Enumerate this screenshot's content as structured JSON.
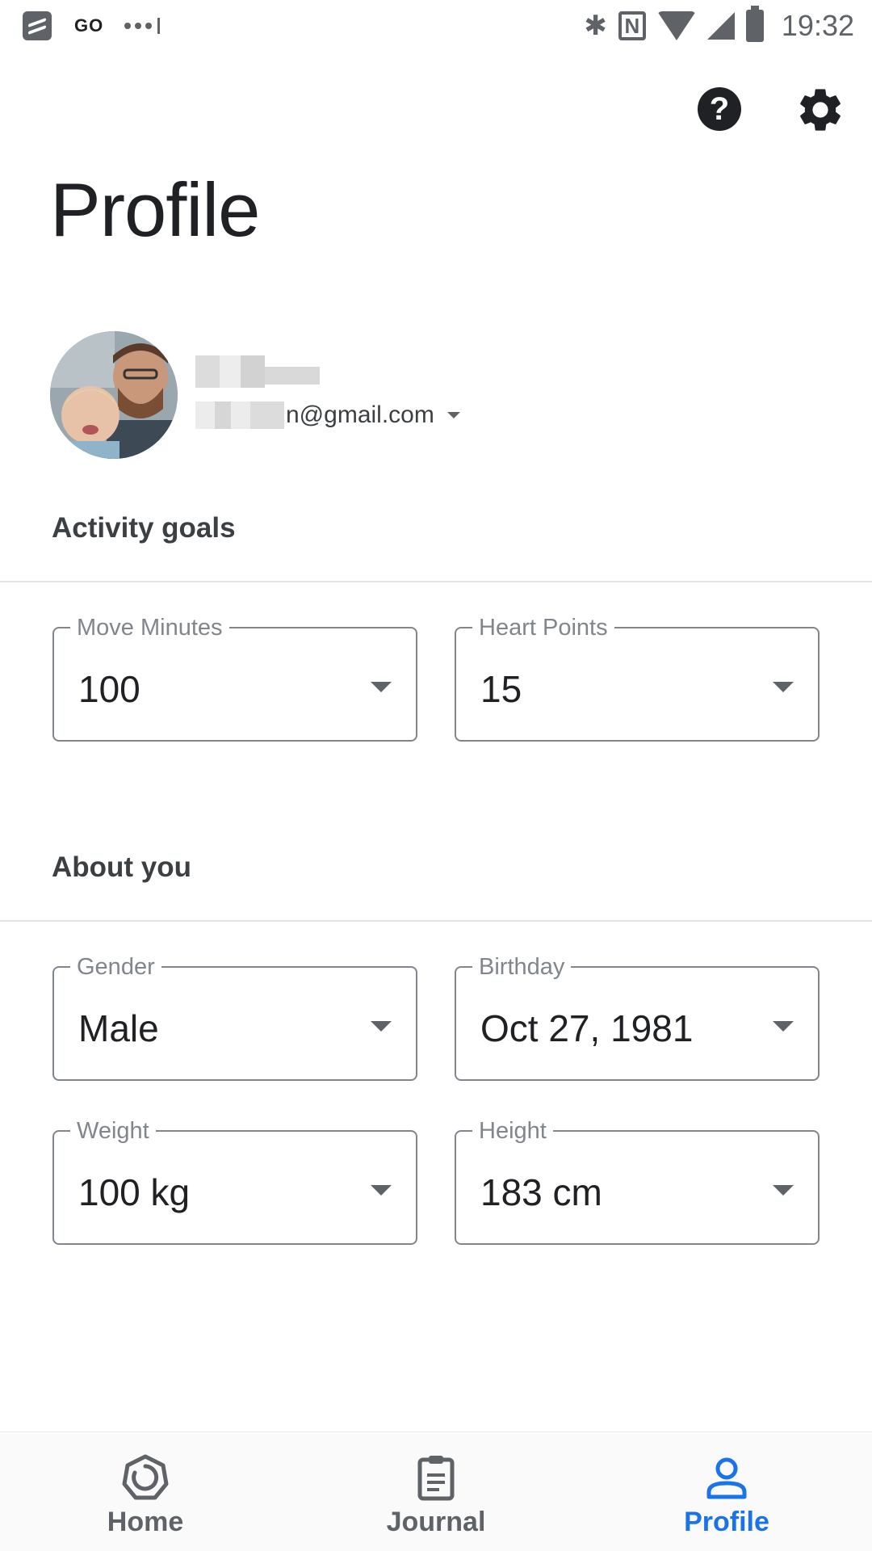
{
  "status_bar": {
    "carrier": "GO",
    "time": "19:32"
  },
  "header": {
    "title": "Profile"
  },
  "account": {
    "email": "n@gmail.com"
  },
  "activity_goals": {
    "title": "Activity goals",
    "move_minutes": {
      "label": "Move Minutes",
      "value": "100"
    },
    "heart_points": {
      "label": "Heart Points",
      "value": "15"
    }
  },
  "about_you": {
    "title": "About you",
    "gender": {
      "label": "Gender",
      "value": "Male"
    },
    "birthday": {
      "label": "Birthday",
      "value": "Oct 27, 1981"
    },
    "weight": {
      "label": "Weight",
      "value": "100 kg"
    },
    "height": {
      "label": "Height",
      "value": "183 cm"
    }
  },
  "bottom_nav": {
    "items": [
      {
        "label": "Home",
        "icon": "home-ring-icon",
        "active": false
      },
      {
        "label": "Journal",
        "icon": "journal-icon",
        "active": false
      },
      {
        "label": "Profile",
        "icon": "profile-icon",
        "active": true
      }
    ]
  },
  "colors": {
    "accent": "#1a73e8",
    "text_primary": "#202124",
    "outline": "#80868b"
  }
}
